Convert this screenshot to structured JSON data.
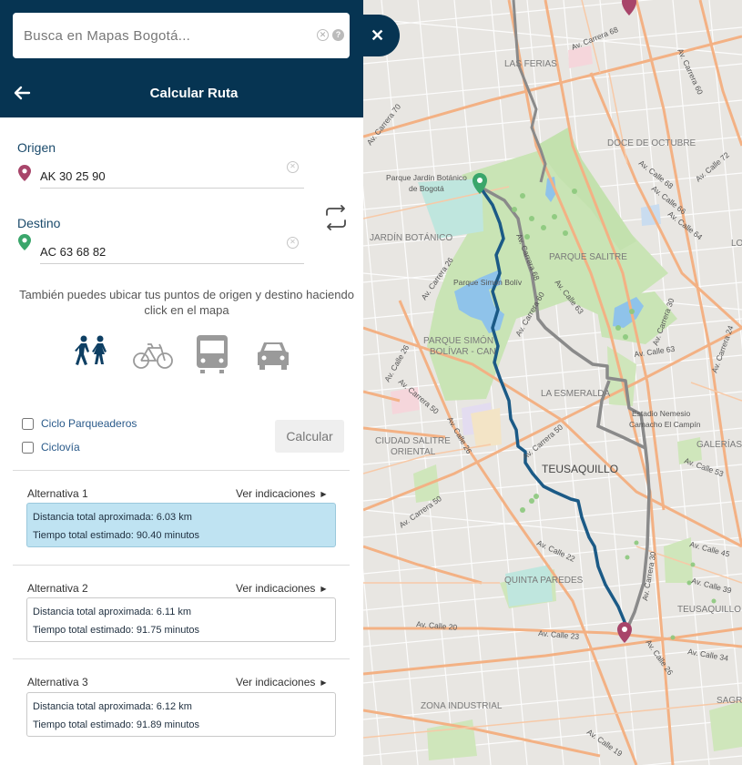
{
  "search": {
    "placeholder": "Busca en Mapas Bogotá..."
  },
  "header": {
    "title": "Calcular Ruta"
  },
  "origin": {
    "label": "Origen",
    "value": "AK 30 25 90"
  },
  "destination": {
    "label": "Destino",
    "value": "AC 63 68 82"
  },
  "hint": "También puedes ubicar tus puntos de origen y destino haciendo click en el mapa",
  "modes": [
    "walk-icon",
    "bicycle-icon",
    "bus-icon",
    "car-icon"
  ],
  "options": {
    "ciclo_parqueaderos": "Ciclo Parqueaderos",
    "ciclovia": "Ciclovía"
  },
  "calculate_label": "Calcular",
  "alternatives": [
    {
      "title": "Alternativa 1",
      "link": "Ver indicaciones",
      "distance": "Distancia total aproximada: 6.03 km",
      "time": "Tiempo total estimado: 90.40 minutos",
      "selected": true
    },
    {
      "title": "Alternativa 2",
      "link": "Ver indicaciones",
      "distance": "Distancia total aproximada: 6.11 km",
      "time": "Tiempo total estimado: 91.75 minutos",
      "selected": false
    },
    {
      "title": "Alternativa 3",
      "link": "Ver indicaciones",
      "distance": "Distancia total aproximada: 6.12 km",
      "time": "Tiempo total estimado: 91.89 minutos",
      "selected": false
    }
  ],
  "colors": {
    "header": "#063452",
    "route_primary": "#1b5a86",
    "route_alt": "#8a8a8a",
    "origin_pin": "#a8456a",
    "destination_pin": "#3aa66b"
  },
  "map": {
    "labels": {
      "las_ferias": "LAS FERIAS",
      "doce_octubre": "DOCE DE OCTUBRE",
      "parque_botanico": "Parque Jardín Botánico",
      "parque_botanico_2": "de Bogotá",
      "jardin_botanico": "JARDÍN BOTÁNICO",
      "parque_salitre": "PARQUE SALITRE",
      "parque_simon": "Parque Simón Bolív",
      "parque_simon_can": "PARQUE SIMÓN",
      "parque_simon_can_2": "BOLÍVAR - CAN",
      "la_esmeralda": "LA ESMERALDA",
      "estadio": "Estadio Nemesio",
      "estadio_2": "Camacho El Campín",
      "ciudad_salitre": "CIUDAD SALITRE",
      "ciudad_salitre_2": "ORIENTAL",
      "teusaquillo": "TEUSAQUILLO",
      "teusaquillo_2": "TEUSAQUILLO",
      "galerias": "GALERÍAS",
      "quinta_paredes": "QUINTA PAREDES",
      "zona_industrial": "ZONA INDUSTRIAL",
      "lo": "LO",
      "sagr": "SAGR",
      "av_carrera_68_top": "Av. Carrera 68",
      "av_carrera_70": "Av. Carrera 70",
      "av_carrera_60": "Av. Carrera 60",
      "av_calle_72": "Av. Calle 72",
      "av_calle_68": "Av. Calle 68",
      "av_calle_66": "Av. Calle 66",
      "av_calle_64": "Av. Calle 64",
      "av_calle_63": "Av. Calle 63",
      "av_calle_63_b": "Av. Calle 63",
      "av_carrera_68_mid": "Av. Carrera 68",
      "av_carrera_60_mid": "Av. Carrera 60",
      "av_carrera_30": "Av. Carrera 30",
      "av_carrera_24": "Av. Carrera 24",
      "av_carrera_26": "Av. Carrera 26",
      "av_calle_26": "Av. Calle 26",
      "av_calle_26_b": "Av. Calle 26",
      "av_carrera_50": "Av. Carrera 50",
      "av_carrera_50_b": "Av. Carrera 50",
      "av_calle_53": "Av. Calle 53",
      "av_calle_45": "Av. Calle 45",
      "av_calle_39": "Av. Calle 39",
      "av_carrera_30_b": "Av. Carrera 30",
      "av_calle_20": "Av. Calle 20",
      "av_calle_23": "Av. Calle 23",
      "av_calle_34": "Av. Calle 34",
      "av_calle_26_c": "Av. Calle 26",
      "av_calle_19": "Av. Calle 19",
      "av_carrera_50_c": "Av. Carrera 50",
      "av_calle_22": "Av. Calle 22"
    }
  }
}
